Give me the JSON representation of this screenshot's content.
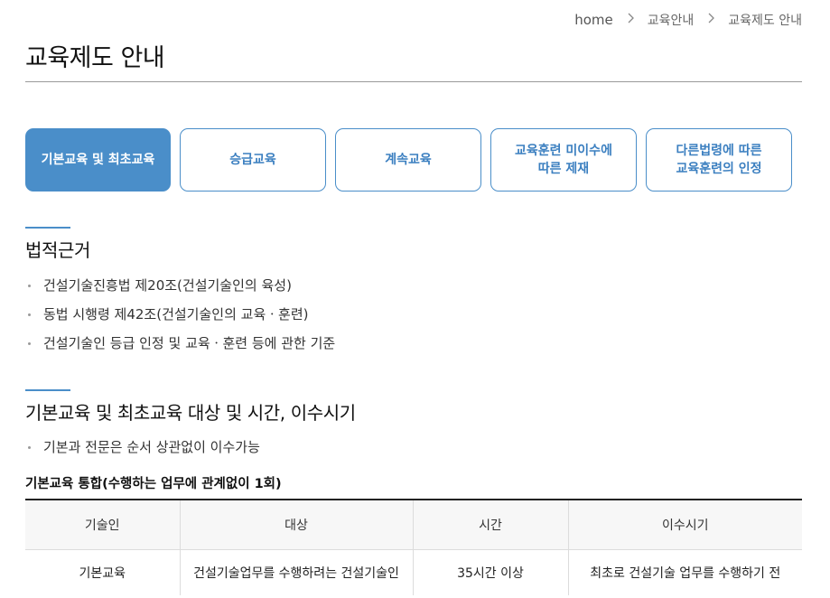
{
  "breadcrumb": {
    "home": "home",
    "level1": "교육안내",
    "level2": "교육제도 안내",
    "separator": ">"
  },
  "page_title": "교육제도 안내",
  "tabs": [
    {
      "label": "기본교육 및 최초교육",
      "active": true
    },
    {
      "label": "승급교육",
      "active": false
    },
    {
      "label": "계속교육",
      "active": false
    },
    {
      "label": "교육훈련 미이수에\n따른 제재",
      "active": false
    },
    {
      "label": "다른법령에 따른\n교육훈련의 인정",
      "active": false
    }
  ],
  "section1": {
    "title": "법적근거",
    "items": [
      "건설기술진흥법 제20조(건설기술인의 육성)",
      "동법 시행령 제42조(건설기술인의 교육ㆍ훈련)",
      "건설기술인 등급 인정 및 교육ㆍ훈련 등에 관한 기준"
    ]
  },
  "section2": {
    "title": "기본교육 및 최초교육 대상 및 시간, 이수시기",
    "items": [
      "기본과 전문은 순서 상관없이 이수가능"
    ],
    "table_title": "기본교육 통합(수행하는 업무에 관계없이 1회)",
    "table": {
      "headers": [
        "기술인",
        "대상",
        "시간",
        "이수시기"
      ],
      "rows": [
        [
          "기본교육",
          "건설기술업무를 수행하려는 건설기술인",
          "35시간 이상",
          "최초로 건설기술 업무를 수행하기 전"
        ]
      ]
    }
  },
  "colors": {
    "accent": "#4a8ec9",
    "tab_text": "#3b7fc0",
    "rule": "#9a9a9a"
  }
}
